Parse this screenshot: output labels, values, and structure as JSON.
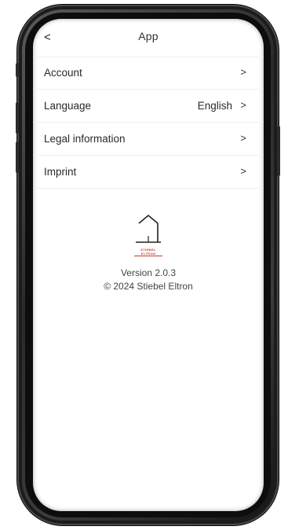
{
  "header": {
    "back_icon": "chevron-left-icon",
    "back_symbol": "<",
    "title": "App"
  },
  "menu": {
    "items": [
      {
        "label": "Account",
        "value": "",
        "chevron": ">"
      },
      {
        "label": "Language",
        "value": "English",
        "chevron": ">"
      },
      {
        "label": "Legal information",
        "value": "",
        "chevron": ">"
      },
      {
        "label": "Imprint",
        "value": "",
        "chevron": ">"
      }
    ]
  },
  "brand": {
    "logo_icon": "house-outline-icon",
    "logo_wordmark": "STIEBEL ELTRON",
    "logo_color": "#c0392b",
    "version": "Version 2.0.3",
    "copyright": "© 2024 Stiebel Eltron"
  }
}
